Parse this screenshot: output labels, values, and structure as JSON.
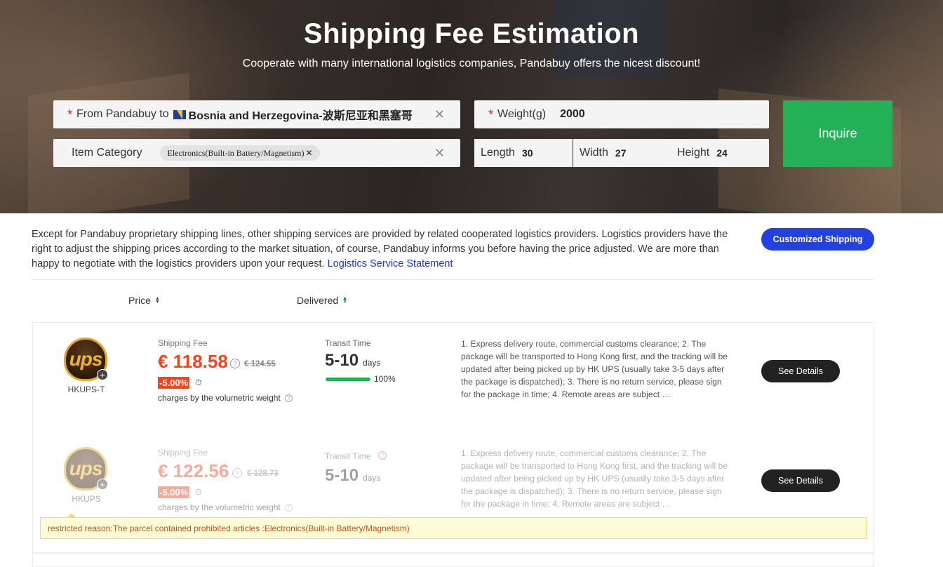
{
  "hero": {
    "title": "Shipping Fee Estimation",
    "subtitle": "Cooperate with many international logistics companies, Pandabuy offers the nicest discount!"
  },
  "form": {
    "from_label": "From Pandabuy to",
    "destination": "Bosnia and Herzegovina-波斯尼亚和黑塞哥",
    "weight_label": "Weight(g)",
    "weight_value": "2000",
    "category_label": "Item Category",
    "category_tag": "Electronics(Built-in Battery/Magnetism)",
    "length_label": "Length",
    "length_value": "30",
    "width_label": "Width",
    "width_value": "27",
    "height_label": "Height",
    "height_value": "24",
    "inquire_label": "Inquire"
  },
  "notice": {
    "text": "Except for Pandabuy proprietary shipping lines, other shipping services are provided by related cooperated logistics providers. Logistics providers have the right to adjust the shipping prices according to the market situation, of course, Pandabuy informs you before having the price adjusted. We are more than happy to negotiate with the logistics providers upon your request.",
    "link": "Logistics Service Statement",
    "custom_button": "Customized Shipping"
  },
  "sort": {
    "price": "Price",
    "delivered": "Delivered"
  },
  "routes": [
    {
      "logo_text": "ups",
      "carrier": "HKUPS-T",
      "fee_label": "Shipping Fee",
      "price": "€ 118.58",
      "old_price": "€ 124.55",
      "discount": "-5.00%",
      "volumetric": "charges by the volumetric weight",
      "transit_label": "Transit Time",
      "transit": "5-10",
      "transit_unit": "days",
      "on_time_pct": 100,
      "on_time_text": "100%",
      "description": "1. Express delivery route, commercial customs clearance; 2. The package will be transported to Hong Kong first, and the tracking will be updated after being picked up by HK UPS (usually take 3-5 days after the package is dispatched); 3. There is no return service, please sign for the package in time; 4. Remote areas are subject …",
      "button": "See Details"
    },
    {
      "logo_text": "ups",
      "carrier": "HKUPS",
      "fee_label": "Shipping Fee",
      "price": "€ 122.56",
      "old_price": "€ 128.73",
      "discount": "-5.00%",
      "volumetric": "charges by the volumetric weight",
      "transit_label": "Transit Time",
      "transit": "5-10",
      "transit_unit": "days",
      "description": "1. Express delivery route, commercial customs clearance; 2. The package will be transported to Hong Kong first, and the tracking will be updated after being picked up by HK UPS (usually take 3-5 days after the package is dispatched); 3. There is no return service, please sign for the package in time; 4. Remote areas are subject …",
      "button": "See Details",
      "restricted_reason": "restricted reason:The parcel contained prohibited articles :Electronics(Built-in Battery/Magnetism)"
    }
  ],
  "colors": {
    "accent_green": "#23b056",
    "price_red": "#f2451c",
    "link_blue": "#1a35d4",
    "custom_button_blue": "#2340e0"
  }
}
